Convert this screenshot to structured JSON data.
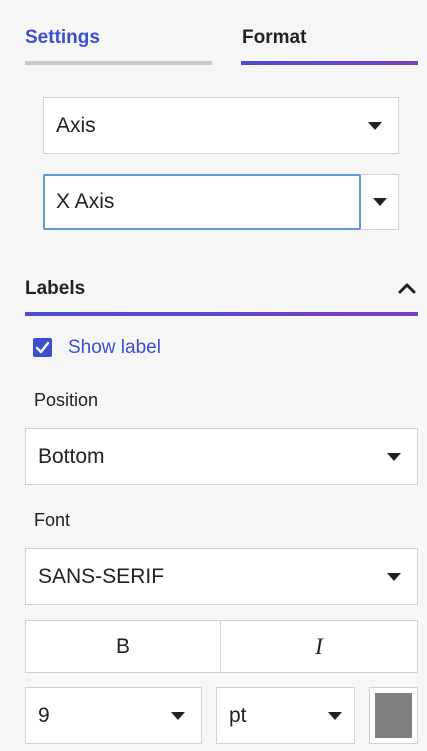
{
  "tabs": {
    "settings_label": "Settings",
    "format_label": "Format",
    "active": "Format"
  },
  "element_select": {
    "value": "Axis"
  },
  "axis_select": {
    "value": "X Axis"
  },
  "labels_section": {
    "title": "Labels",
    "expanded": true,
    "show_label": {
      "label": "Show label",
      "checked": true
    },
    "position": {
      "label": "Position",
      "value": "Bottom"
    },
    "font": {
      "label": "Font",
      "value": "SANS-SERIF"
    },
    "bold_label": "B",
    "italic_label": "I",
    "font_size": {
      "value": "9"
    },
    "font_unit": {
      "value": "pt"
    },
    "font_color": "#7f7f7f"
  },
  "colors": {
    "accent_blue": "#3b4fd0",
    "accent_gradient_start": "#4b4bd6",
    "accent_gradient_end": "#7d3fc1"
  }
}
